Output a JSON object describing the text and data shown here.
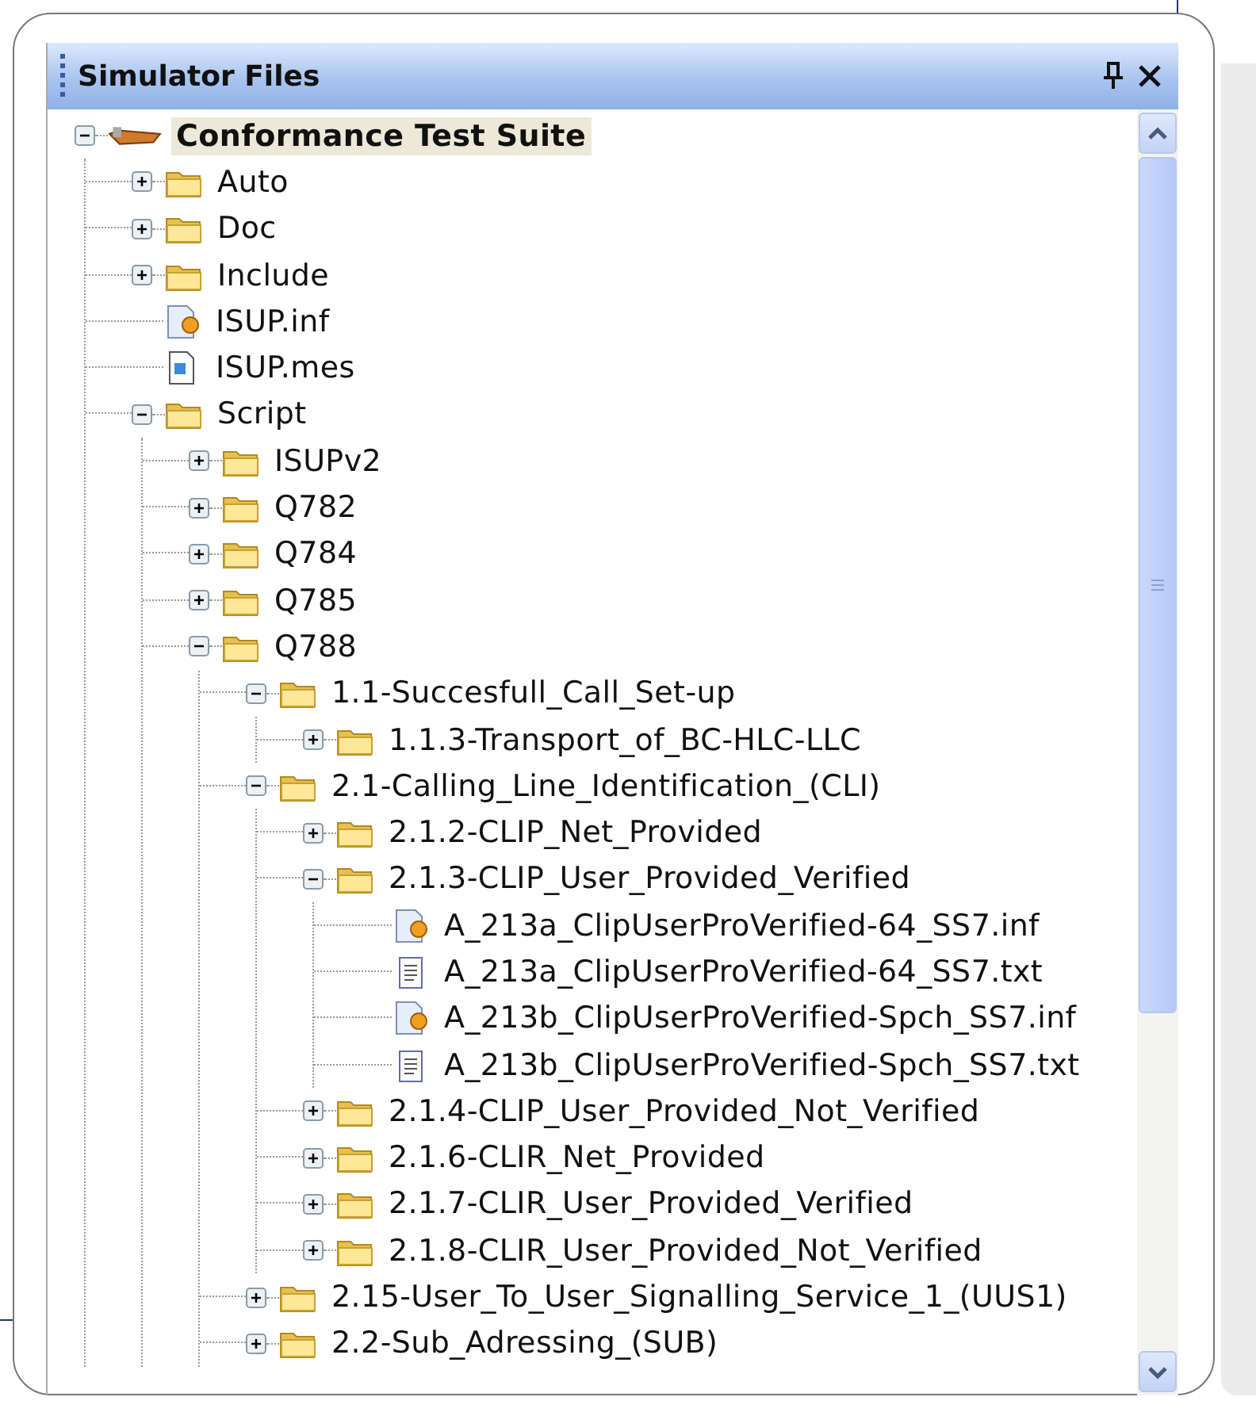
{
  "panel": {
    "title": "Simulator Files"
  },
  "tree": [
    {
      "kind": "root",
      "label": "Conformance Test Suite",
      "selected": true,
      "expanded": true,
      "children": [
        {
          "kind": "folder",
          "label": "Auto",
          "selected": false,
          "expanded": false
        },
        {
          "kind": "folder",
          "label": "Doc",
          "selected": false,
          "expanded": false
        },
        {
          "kind": "folder",
          "label": "Include",
          "selected": false,
          "expanded": false
        },
        {
          "kind": "inf",
          "label": "ISUP.inf",
          "selected": false
        },
        {
          "kind": "mes",
          "label": "ISUP.mes",
          "selected": false
        },
        {
          "kind": "folder",
          "label": "Script",
          "selected": false,
          "expanded": true,
          "children": [
            {
              "kind": "folder",
              "label": "ISUPv2",
              "selected": false,
              "expanded": false
            },
            {
              "kind": "folder",
              "label": "Q782",
              "selected": false,
              "expanded": false
            },
            {
              "kind": "folder",
              "label": "Q784",
              "selected": false,
              "expanded": false
            },
            {
              "kind": "folder",
              "label": "Q785",
              "selected": false,
              "expanded": false
            },
            {
              "kind": "folder",
              "label": "Q788",
              "selected": false,
              "expanded": true,
              "children": [
                {
                  "kind": "folder",
                  "label": "1.1-Succesfull_Call_Set-up",
                  "selected": false,
                  "expanded": true,
                  "children": [
                    {
                      "kind": "folder",
                      "label": "1.1.3-Transport_of_BC-HLC-LLC",
                      "selected": false,
                      "expanded": false
                    }
                  ]
                },
                {
                  "kind": "folder",
                  "label": "2.1-Calling_Line_Identification_(CLI)",
                  "selected": false,
                  "expanded": true,
                  "children": [
                    {
                      "kind": "folder",
                      "label": "2.1.2-CLIP_Net_Provided",
                      "selected": false,
                      "expanded": false
                    },
                    {
                      "kind": "folder",
                      "label": "2.1.3-CLIP_User_Provided_Verified",
                      "selected": false,
                      "expanded": true,
                      "children": [
                        {
                          "kind": "inf",
                          "label": "A_213a_ClipUserProVerified-64_SS7.inf",
                          "selected": false
                        },
                        {
                          "kind": "txt",
                          "label": "A_213a_ClipUserProVerified-64_SS7.txt",
                          "selected": false
                        },
                        {
                          "kind": "inf",
                          "label": "A_213b_ClipUserProVerified-Spch_SS7.inf",
                          "selected": false
                        },
                        {
                          "kind": "txt",
                          "label": "A_213b_ClipUserProVerified-Spch_SS7.txt",
                          "selected": false
                        }
                      ]
                    },
                    {
                      "kind": "folder",
                      "label": "2.1.4-CLIP_User_Provided_Not_Verified",
                      "selected": false,
                      "expanded": false
                    },
                    {
                      "kind": "folder",
                      "label": "2.1.6-CLIR_Net_Provided",
                      "selected": false,
                      "expanded": false
                    },
                    {
                      "kind": "folder",
                      "label": "2.1.7-CLIR_User_Provided_Verified",
                      "selected": false,
                      "expanded": false
                    },
                    {
                      "kind": "folder",
                      "label": "2.1.8-CLIR_User_Provided_Not_Verified",
                      "selected": false,
                      "expanded": false
                    }
                  ]
                },
                {
                  "kind": "folder",
                  "label": "2.15-User_To_User_Signalling_Service_1_(UUS1)",
                  "selected": false,
                  "expanded": false
                },
                {
                  "kind": "folder",
                  "label": "2.2-Sub_Adressing_(SUB)",
                  "selected": false,
                  "expanded": false
                }
              ]
            }
          ]
        }
      ]
    }
  ]
}
